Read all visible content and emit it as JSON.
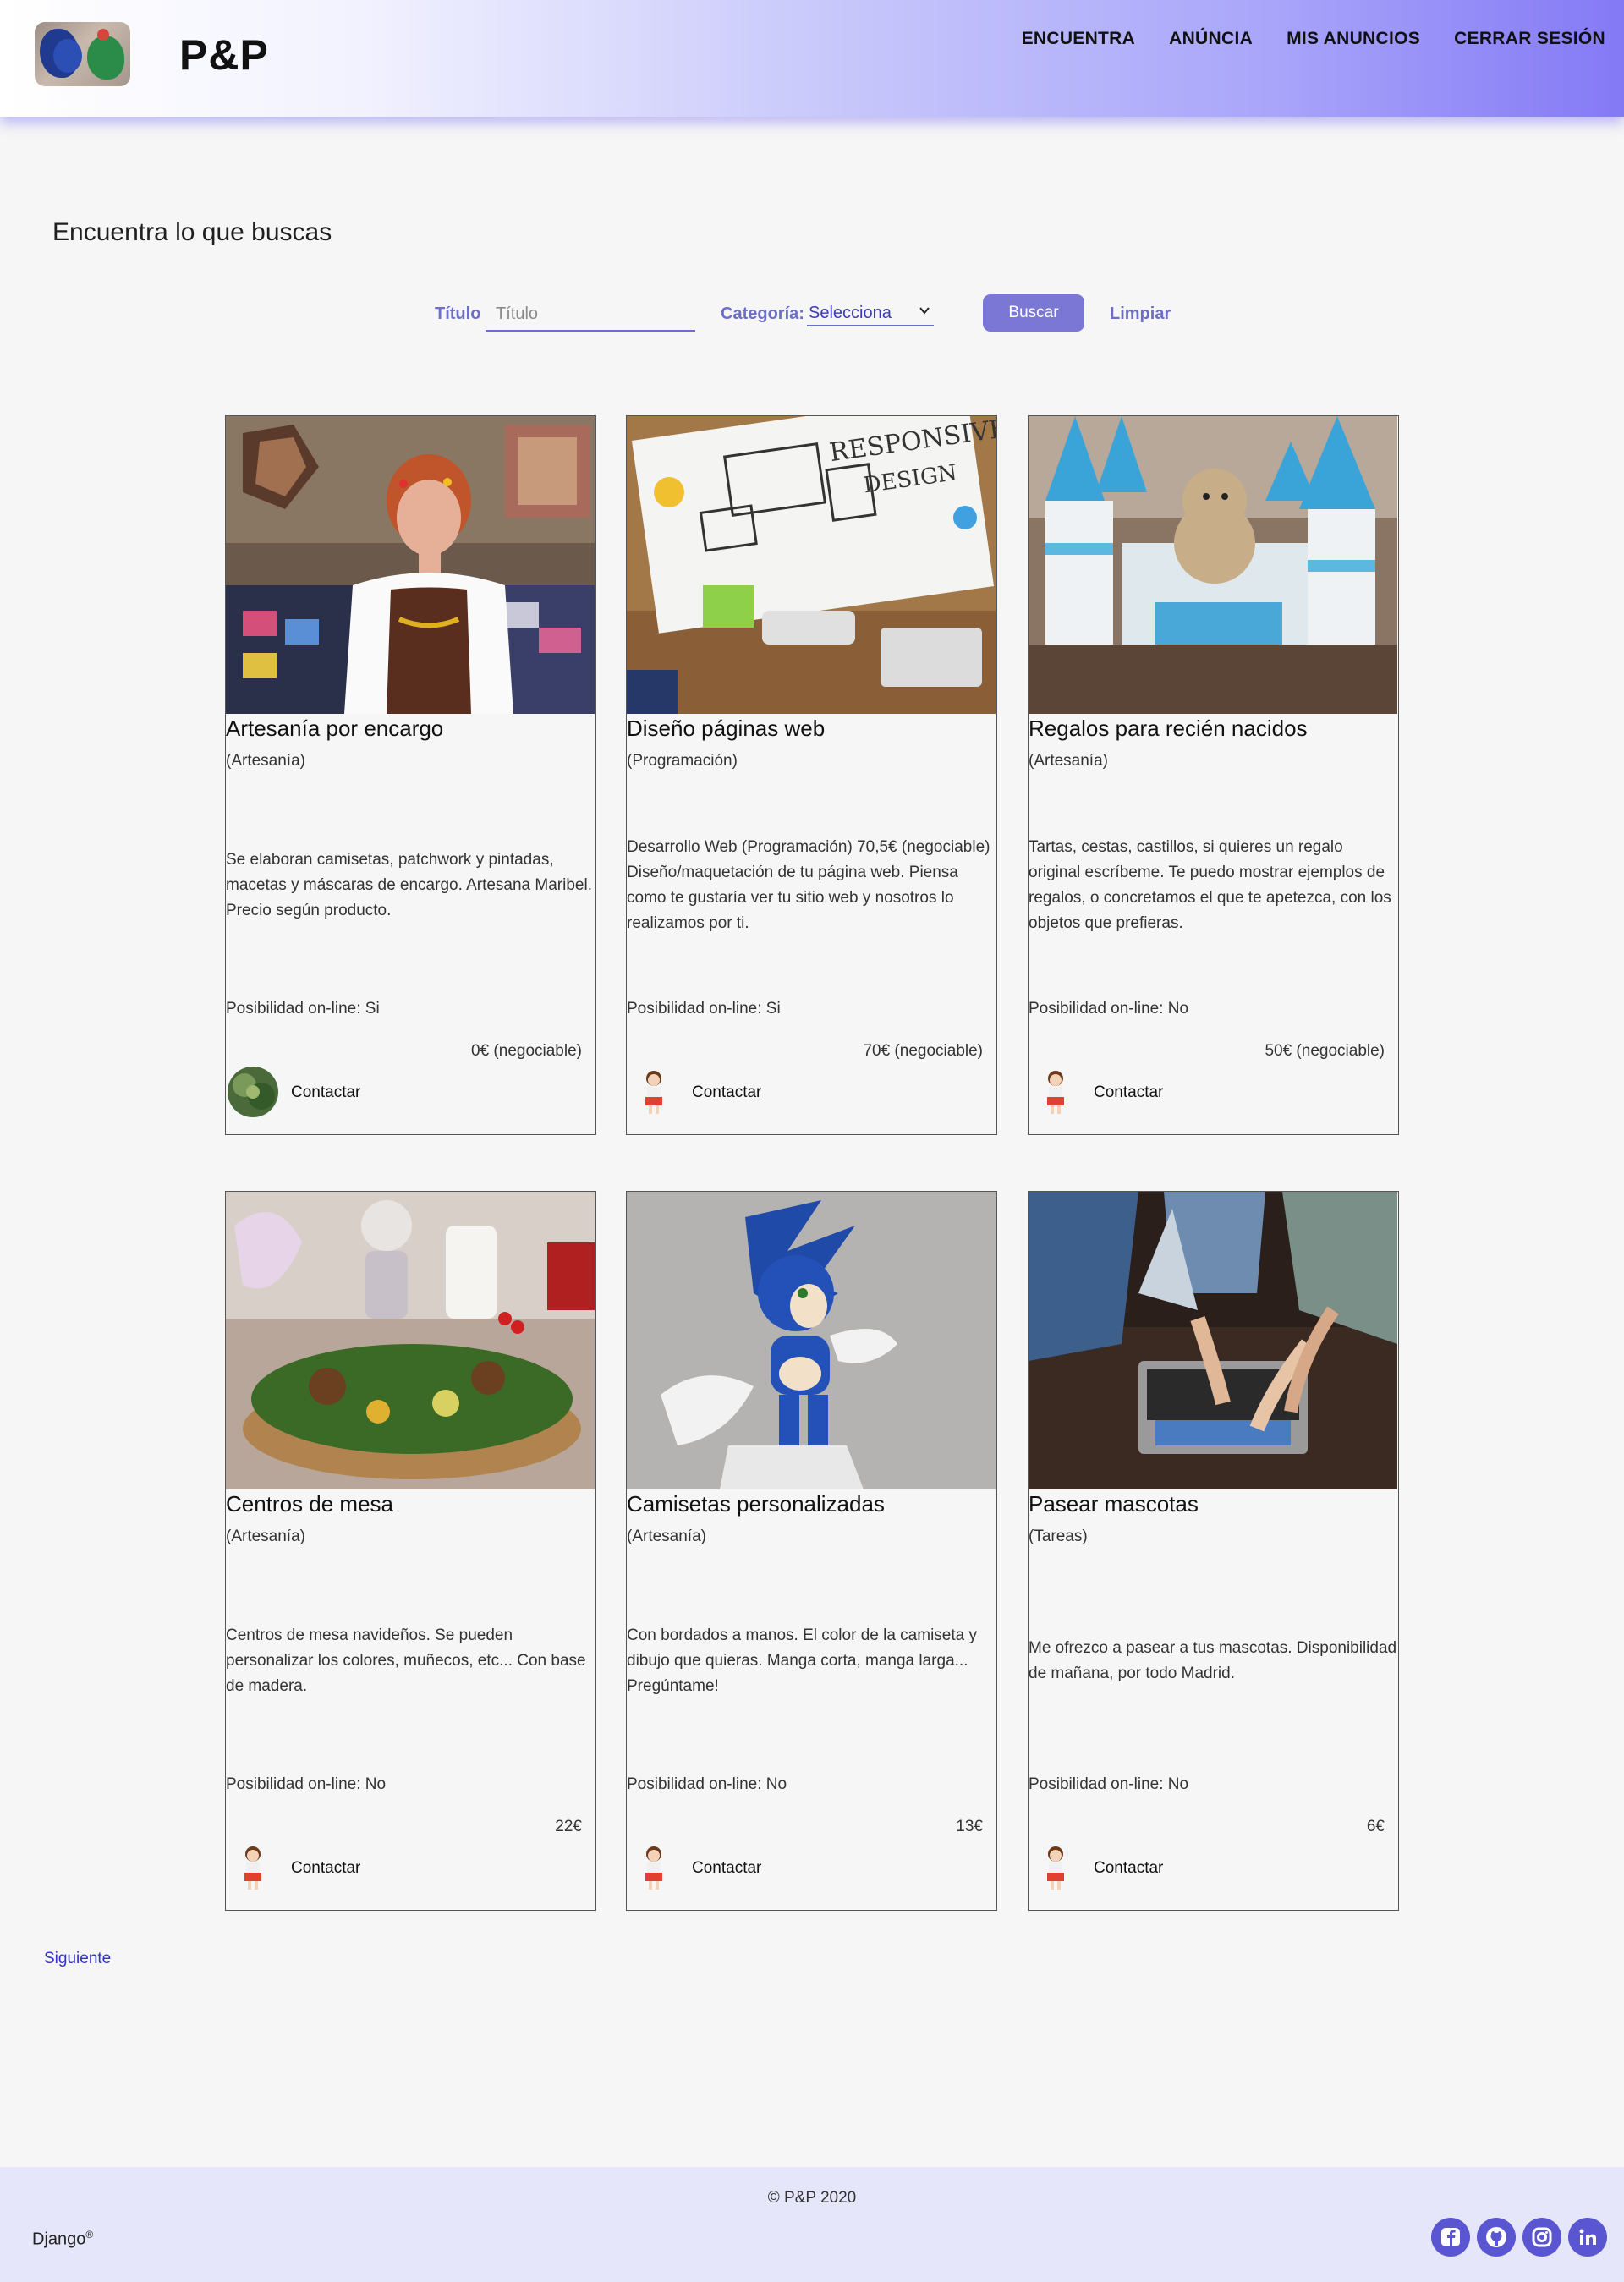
{
  "header": {
    "brand": "P&P",
    "nav": [
      "ENCUENTRA",
      "ANÚNCIA",
      "MIS ANUNCIOS",
      "CERRAR SESIÓN"
    ]
  },
  "main": {
    "title": "Encuentra lo que buscas",
    "search": {
      "title_label": "Título",
      "title_placeholder": "Título",
      "category_label": "Categoría:",
      "category_selected": "Selecciona",
      "search_button": "Buscar",
      "clear_button": "Limpiar"
    },
    "cards": [
      {
        "title": "Artesanía por encargo",
        "category": "(Artesanía)",
        "description": "Se elaboran camisetas, patchwork y pintadas, macetas y máscaras de encargo. Artesana Maribel. Precio según producto.",
        "online": "Posibilidad on-line: Si",
        "price": "0€  (negociable)",
        "contact": "Contactar",
        "image": "woman-at-craft-market",
        "avatar": "plant-avatar"
      },
      {
        "title": "Diseño páginas web",
        "category": "(Programación)",
        "description": "Desarrollo Web (Programación) 70,5€ (negociable) Diseño/maquetación de tu página web. Piensa como te gustaría ver tu sitio web y nosotros lo realizamos por ti.",
        "online": "Posibilidad on-line: Si",
        "price": "70€  (negociable)",
        "contact": "Contactar",
        "image": "responsive-design-desk",
        "avatar": "girl-avatar"
      },
      {
        "title": "Regalos para recién nacidos",
        "category": "(Artesanía)",
        "description": "Tartas, cestas, castillos, si quieres un regalo original escríbeme. Te puedo mostrar ejemplos de regalos, o concretamos el que te apetezca, con los objetos que prefieras.",
        "online": "Posibilidad on-line: No",
        "price": "50€  (negociable)",
        "contact": "Contactar",
        "image": "diaper-castle",
        "avatar": "girl-avatar"
      },
      {
        "title": "Centros de mesa",
        "category": "(Artesanía)",
        "description": "Centros de mesa navideños. Se pueden personalizar los colores, muñecos, etc... Con base de madera.",
        "online": "Posibilidad on-line: No",
        "price": "22€",
        "contact": "Contactar",
        "image": "christmas-centerpiece",
        "avatar": "girl-avatar"
      },
      {
        "title": "Camisetas personalizadas",
        "category": "(Artesanía)",
        "description": "Con bordados a manos. El color de la camiseta y dibujo que quieras. Manga corta, manga larga... Pregúntame!",
        "online": "Posibilidad on-line: No",
        "price": "13€",
        "contact": "Contactar",
        "image": "embroidered-tshirt",
        "avatar": "girl-avatar"
      },
      {
        "title": "Pasear mascotas",
        "category": "(Tareas)",
        "description": "Me ofrezco a pasear a tus mascotas. Disponibilidad de mañana, por todo Madrid.",
        "online": "Posibilidad on-line: No",
        "price": "6€",
        "contact": "Contactar",
        "image": "hands-on-laptop",
        "avatar": "girl-avatar"
      }
    ],
    "pagination_next": "Siguiente"
  },
  "footer": {
    "copyright": "© P&P 2020",
    "django": "Django",
    "django_mark": "®",
    "social": [
      "facebook-icon",
      "github-icon",
      "instagram-icon",
      "linkedin-icon"
    ]
  },
  "colors": {
    "accent": "#6d6ec9",
    "button": "#7a78d4",
    "footer_bg": "#e6e6fa",
    "social": "#5a55d0"
  }
}
